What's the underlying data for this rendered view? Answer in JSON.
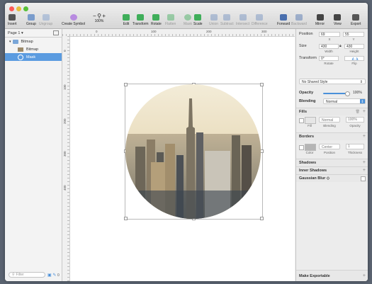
{
  "toolbar": {
    "insert": "Insert",
    "group": "Group",
    "ungroup": "Ungroup",
    "create_symbol": "Create Symbol",
    "zoom": "100%",
    "zoom_minus": "−",
    "zoom_plus": "+",
    "edit": "Edit",
    "transform": "Transform",
    "rotate": "Rotate",
    "flatten": "Flatten",
    "mask": "Mask",
    "scale": "Scale",
    "union": "Union",
    "subtract": "Subtract",
    "intersect": "Intersect",
    "difference": "Difference",
    "forward": "Forward",
    "backward": "Backward",
    "mirror": "Mirror",
    "view": "View",
    "export": "Export"
  },
  "left_panel": {
    "page_selector": "Page 1 ▾",
    "layers": [
      {
        "name": "Bitmap",
        "level": 0,
        "selected": false
      },
      {
        "name": "Bitmap",
        "level": 1,
        "selected": false
      },
      {
        "name": "Mask",
        "level": 1,
        "selected": true
      }
    ],
    "filter_placeholder": "Filter",
    "filter_badge": "0"
  },
  "rulers": {
    "h": [
      "0",
      "100",
      "200",
      "300"
    ],
    "v": [
      "0",
      "100",
      "200",
      "300",
      "400"
    ]
  },
  "inspector": {
    "position_label": "Position",
    "x": "69",
    "y": "55",
    "x_cap": "X",
    "y_cap": "Y",
    "size_label": "Size",
    "width": "430",
    "height": "430",
    "width_cap": "Width",
    "height_cap": "Height",
    "transform_label": "Transform",
    "rotate": "0°",
    "rotate_cap": "Rotate",
    "flip_cap": "Flip",
    "shared_style": "No Shared Style",
    "opacity_label": "Opacity",
    "opacity_value": "100%",
    "blending_label": "Blending",
    "blending_value": "Normal",
    "fills_title": "Fills",
    "fill_blend": "Normal",
    "fill_opacity": "100%",
    "fill_caps": {
      "fill": "Fill",
      "blending": "Blending",
      "opacity": "Opacity"
    },
    "borders_title": "Borders",
    "border_position": "Center",
    "border_thickness": "1",
    "border_caps": {
      "color": "Color",
      "position": "Position",
      "thickness": "Thickness"
    },
    "shadows_title": "Shadows",
    "inner_shadows_title": "Inner Shadows",
    "gaussian_title": "Gaussian Blur ◇",
    "make_exportable": "Make Exportable"
  },
  "colors": {
    "accent": "#4a90d9",
    "selection": "#5a9be0"
  }
}
